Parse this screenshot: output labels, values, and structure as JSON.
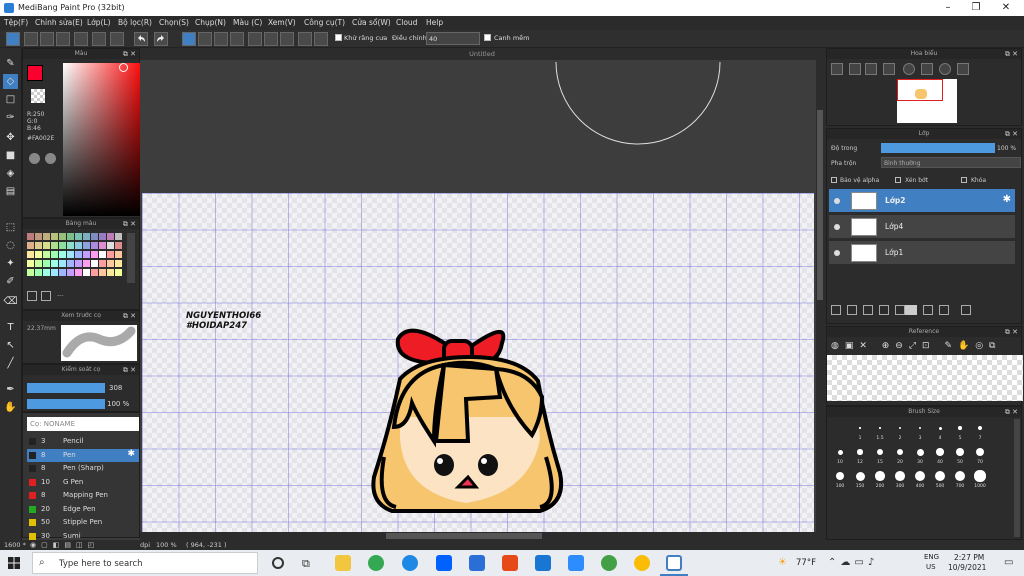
{
  "window": {
    "title": "MediBang Paint Pro (32bit)"
  },
  "menu": [
    "Tệp(F)",
    "Chỉnh sửa(E)",
    "Lớp(L)",
    "Bộ lọc(R)",
    "Chọn(S)",
    "Chụp(N)",
    "Màu (C)",
    "Xem(V)",
    "Công cụ(T)",
    "Cửa sổ(W)",
    "Cloud",
    "Help"
  ],
  "toolbar": {
    "antialias_label": "Khử răng cưa",
    "adjust_label": "Điều chỉnh",
    "adjust_value": "40",
    "snap_label": "Canh mềm"
  },
  "panels": {
    "color": {
      "title": "Màu",
      "r": "R:250",
      "g": "G:0",
      "b": "B:46",
      "hex": "#FA002E",
      "primary": "#fa002e"
    },
    "palette": {
      "title": "Bảng màu",
      "extra": "---"
    },
    "brush_preview": {
      "title": "Xem trước cọ",
      "size": "22.37mm"
    },
    "brush_control": {
      "title": "Kiểm soát cọ",
      "size": "308",
      "opacity": "100 %"
    },
    "brush_list": {
      "search": "Cọ: NONAME",
      "items": [
        {
          "size": "3",
          "name": "Pencil",
          "color": "#222222"
        },
        {
          "size": "8",
          "name": "Pen",
          "color": "#222222"
        },
        {
          "size": "8",
          "name": "Pen (Sharp)",
          "color": "#222222"
        },
        {
          "size": "10",
          "name": "G Pen",
          "color": "#e02020"
        },
        {
          "size": "8",
          "name": "Mapping Pen",
          "color": "#e02020"
        },
        {
          "size": "20",
          "name": "Edge Pen",
          "color": "#22aa22"
        },
        {
          "size": "50",
          "name": "Stipple Pen",
          "color": "#e0c000"
        },
        {
          "size": "30",
          "name": "Sumi",
          "color": "#e0c000"
        }
      ]
    },
    "navigator": {
      "title": "Hoa biểu"
    },
    "layers": {
      "title": "Lớp",
      "opacity_label": "Độ trong",
      "opacity_value": "100 %",
      "blend_label": "Pha trộn",
      "blend_value": "Bình thường",
      "protect_alpha": "Bảo vệ alpha",
      "clipping": "Xén bớt",
      "lock": "Khóa",
      "items": [
        "Lớp2",
        "Lớp4",
        "Lớp1"
      ]
    },
    "reference": {
      "title": "Reference"
    },
    "brush_size": {
      "title": "Brush Size",
      "labels": [
        "1",
        "1.5",
        "2",
        "3",
        "4",
        "5",
        "7",
        "10",
        "12",
        "15",
        "20",
        "30",
        "40",
        "50",
        "70",
        "100",
        "150",
        "200",
        "300",
        "400",
        "500",
        "700",
        "1000"
      ]
    }
  },
  "canvas": {
    "tab_title": "Untitled",
    "watermark_1": "NGUYENTHOI66",
    "watermark_2": "#HOIDAP247"
  },
  "status": {
    "zoom_left": "1600 *",
    "unit": "dpi",
    "zoom": "100 %",
    "coords": "( 964, -231 )"
  },
  "taskbar": {
    "search_placeholder": "Type here to search",
    "weather": "77°F",
    "lang_1": "ENG",
    "lang_2": "US",
    "time": "2:27 PM",
    "date": "10/9/2021"
  }
}
